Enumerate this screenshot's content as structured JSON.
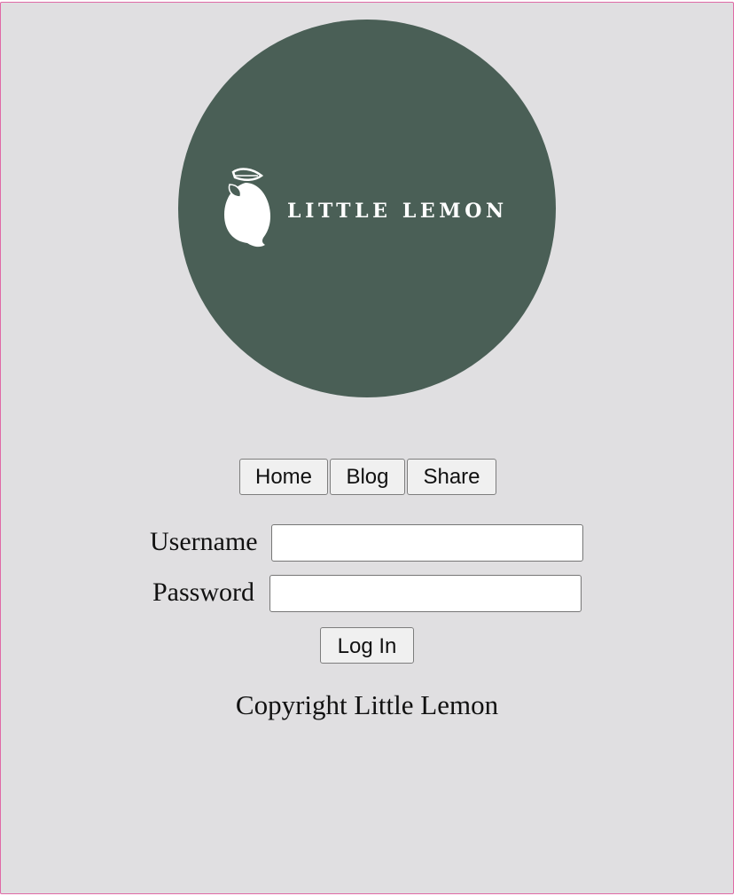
{
  "logo": {
    "text": "LITTLE LEMON",
    "background_color": "#4a5f56",
    "icon": "lemon-icon"
  },
  "nav": {
    "items": [
      {
        "label": "Home"
      },
      {
        "label": "Blog"
      },
      {
        "label": "Share"
      }
    ]
  },
  "login_form": {
    "username_label": "Username",
    "username_value": "",
    "password_label": "Password",
    "password_value": "",
    "submit_label": "Log In"
  },
  "footer": {
    "text": "Copyright Little Lemon"
  },
  "colors": {
    "page_background": "#e0dfe1",
    "frame_border": "#e06aa6"
  }
}
